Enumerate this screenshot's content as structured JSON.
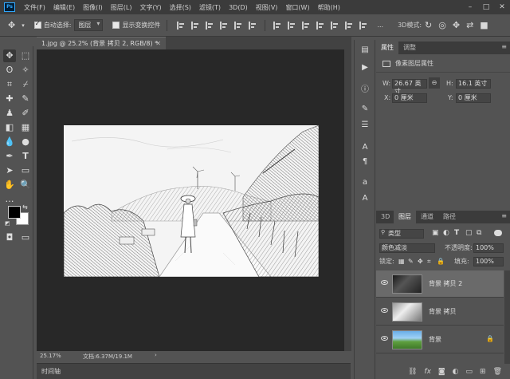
{
  "menu": {
    "logo": "Ps",
    "items": [
      "文件(F)",
      "编辑(E)",
      "图像(I)",
      "图层(L)",
      "文字(Y)",
      "选择(S)",
      "滤镜(T)",
      "3D(D)",
      "视图(V)",
      "窗口(W)",
      "帮助(H)"
    ],
    "window_controls": [
      "–",
      "□",
      "✕"
    ]
  },
  "options": {
    "auto_select_label": "自动选择:",
    "auto_select_target": "图层",
    "show_transform_label": "显示变换控件",
    "more_label": "..."
  },
  "document": {
    "tab_title": "1.jpg @ 25.2% (背景 拷贝 2, RGB/8) *",
    "close_glyph": "✕",
    "zoom": "25.17%",
    "doc_info": "文档:6.37M/19.1M",
    "status_arrow": "›"
  },
  "timeline": {
    "label": "时间轴"
  },
  "properties": {
    "tab_properties": "属性",
    "tab_adjust": "调整",
    "section": "像素图层属性",
    "w_label": "W:",
    "w_value": "26.67 英寸",
    "h_label": "H:",
    "h_value": "16.1 英寸",
    "x_label": "X:",
    "x_value": "0 厘米",
    "y_label": "Y:",
    "y_value": "0 厘米"
  },
  "layers_panel": {
    "tabs": [
      "3D",
      "图层",
      "通道",
      "路径"
    ],
    "filter_kind": "类型",
    "blend_mode": "颜色减淡",
    "opacity_label": "不透明度:",
    "opacity_value": "100%",
    "lock_label": "锁定:",
    "fill_label": "填充:",
    "fill_value": "100%",
    "layers": [
      {
        "name": "背景 拷贝 2",
        "selected": true
      },
      {
        "name": "背景 拷贝",
        "selected": false
      },
      {
        "name": "背景",
        "selected": false,
        "locked": true
      }
    ],
    "bottom_icons": [
      "link-icon",
      "fx-icon",
      "mask-icon",
      "adjustment-icon",
      "folder-icon",
      "new-layer-icon",
      "trash-icon"
    ]
  },
  "colors": {
    "accent": "#31a8ff",
    "canvas_bg": "#282828",
    "panel_bg": "#535353"
  }
}
